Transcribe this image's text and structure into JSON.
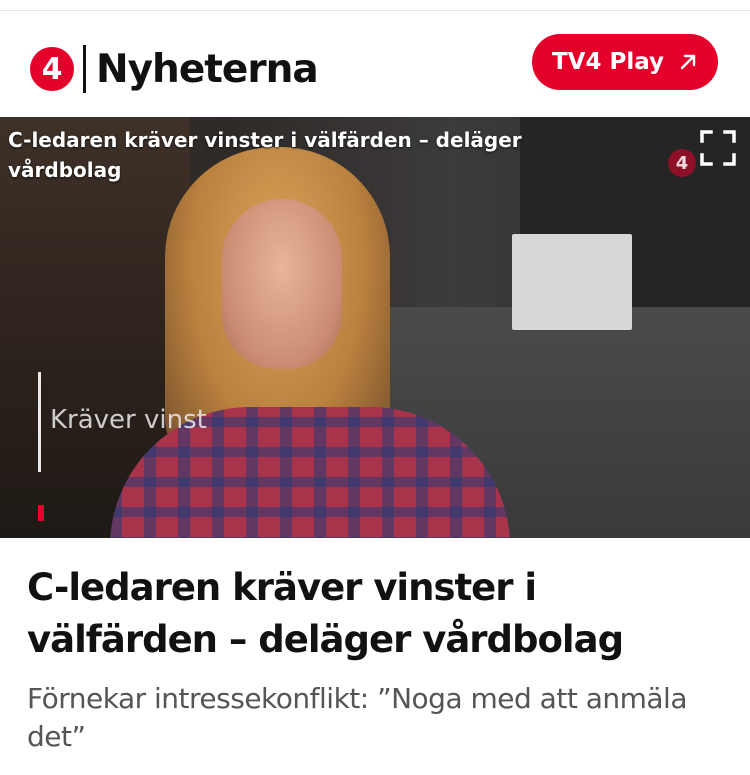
{
  "header": {
    "logo_glyph": "4",
    "brand_name": "Nyheterna",
    "play_button_label": "TV4 Play",
    "play_button_icon": "arrow-up-right-icon",
    "accent_color": "#e4002b"
  },
  "video": {
    "overlay_title": "C-ledaren kräver vinster i välfärden – deläger vårdbolag",
    "lower_third_text": "Kräver vinst",
    "watermark_glyph": "4",
    "fullscreen_icon": "fullscreen-icon"
  },
  "article": {
    "headline": "C-ledaren kräver vinster i välfärden – deläger vårdbolag",
    "subheadline": "Förnekar intressekonflikt: ”Noga med att anmäla det”"
  }
}
